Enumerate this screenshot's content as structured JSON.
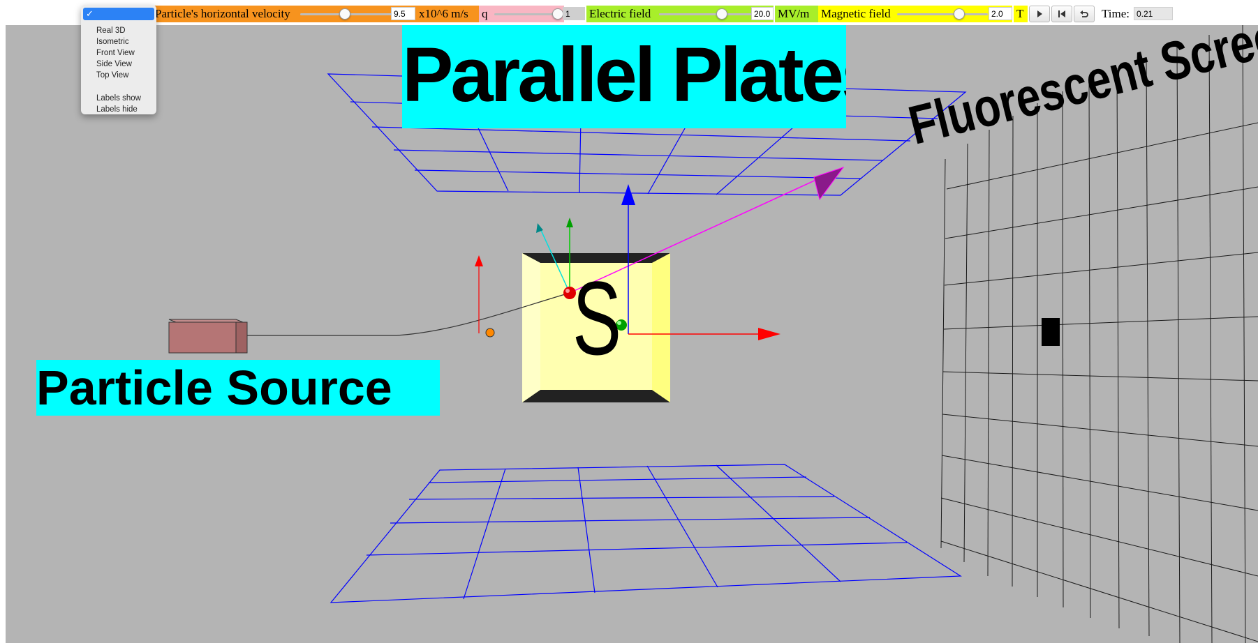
{
  "view_menu": {
    "selected_mark": "✓",
    "selected_label": "",
    "options": [
      "Real 3D",
      "Isometric",
      "Front View",
      "Side View",
      "Top View"
    ],
    "label_options": [
      "Labels show",
      "Labels hide"
    ],
    "selection_color": "#2c82f5"
  },
  "controls": {
    "velocity": {
      "label": "Particle's horizontal velocity",
      "value": "9.5",
      "unit": "x10^6 m/s",
      "color": "#f7931e",
      "slider_fraction": 0.5
    },
    "charge": {
      "label": "q",
      "value": "1",
      "color": "#f9b6c3",
      "slider_fraction": 1.0
    },
    "electric": {
      "label": "Electric field",
      "value": "20.0",
      "unit": "MV/m",
      "color": "#a8ee2a",
      "slider_fraction": 0.72
    },
    "magnetic": {
      "label": "Magnetic field",
      "value": "2.0",
      "unit": "T",
      "color": "#ffff00",
      "slider_fraction": 0.72
    },
    "time": {
      "label": "Time:",
      "value": "0.21"
    }
  },
  "buttons": {
    "play": "play-icon",
    "step": "step-back-icon",
    "reset": "reset-icon"
  },
  "scene": {
    "background": "#b4b4b4",
    "title_plates": "Parallel Plates",
    "title_source": "Particle Source",
    "title_screen": "Fluorescent Scree",
    "box_letter": "S",
    "label_bg": "#00ffff",
    "plate_color": "#0000ff",
    "trajectory_color": "#ff00ff"
  }
}
